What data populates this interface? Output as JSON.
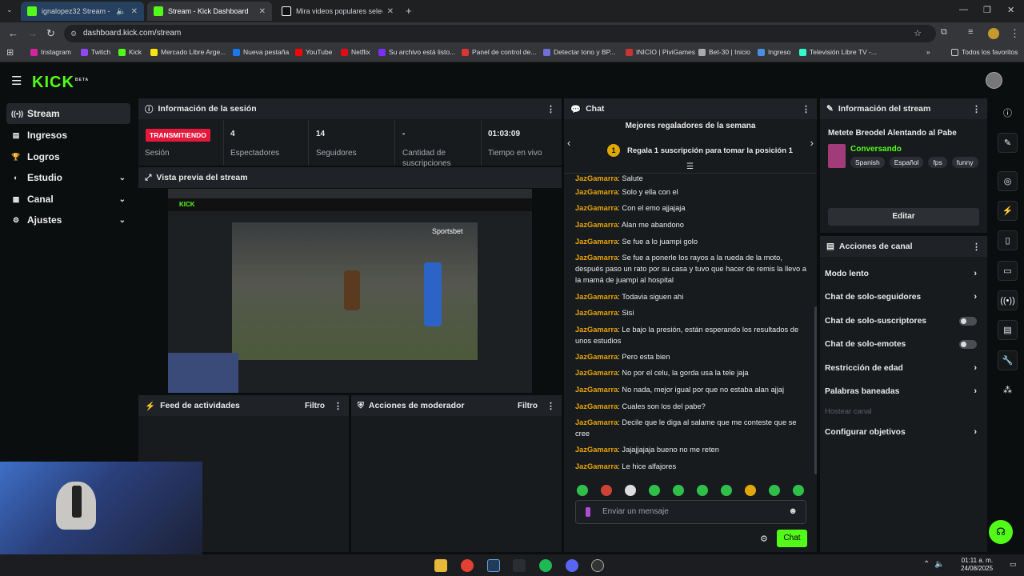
{
  "browser": {
    "tabs": [
      {
        "title": "ignalopez32 Stream - Wat..."
      },
      {
        "title": "Stream - Kick Dashboard"
      },
      {
        "title": "Mira videos populares seleccio"
      }
    ],
    "url": "dashboard.kick.com/stream",
    "bookmarks": [
      "Instagram",
      "Twitch",
      "Kick",
      "Mercado Libre Arge...",
      "Nueva pestaña",
      "YouTube",
      "Netflix",
      "Su archivo está listo...",
      "Panel de control de...",
      "Detectar tono y BP...",
      "INICIO | PiviGames",
      "Bet-30 | Inicio",
      "Ingreso",
      "Televisión Libre TV -..."
    ],
    "all_bookmarks": "Todos los favoritos"
  },
  "app": {
    "logo": "KICK",
    "logo_sup": "BETA"
  },
  "sidebar": {
    "items": [
      {
        "label": "Stream",
        "icon": "broadcast-icon"
      },
      {
        "label": "Ingresos",
        "icon": "revenue-icon"
      },
      {
        "label": "Logros",
        "icon": "trophy-icon"
      },
      {
        "label": "Estudio",
        "icon": "studio-icon"
      },
      {
        "label": "Canal",
        "icon": "channel-icon"
      },
      {
        "label": "Ajustes",
        "icon": "gear-icon"
      }
    ]
  },
  "session": {
    "title": "Información de la sesión",
    "live_badge": "TRANSMITIENDO",
    "live_label": "Sesión",
    "stats": [
      {
        "value": "4",
        "label": "Espectadores"
      },
      {
        "value": "14",
        "label": "Seguidores"
      },
      {
        "value": "-",
        "label": "Cantidad de suscripciones"
      },
      {
        "value": "01:03:09",
        "label": "Tiempo en vivo"
      }
    ]
  },
  "preview": {
    "title": "Vista previa del stream",
    "inner_brand": "Sportsbet",
    "inner_logo": "KICK"
  },
  "feed": {
    "title": "Feed de actividades",
    "filter": "Filtro"
  },
  "mod": {
    "title": "Acciones de moderador",
    "filter": "Filtro"
  },
  "chat": {
    "title": "Chat",
    "gifters_title": "Mejores regaladores de la semana",
    "gift_rank": "1",
    "gift_text": "Regala 1 suscripción para tomar la posición 1",
    "messages": [
      {
        "user": "JazGamarra",
        "text": ": Salute"
      },
      {
        "user": "JazGamarra",
        "text": ": Solo y ella con el"
      },
      {
        "user": "JazGamarra",
        "text": ": Con el emo ajjajaja"
      },
      {
        "user": "JazGamarra",
        "text": ": Alan me abandono"
      },
      {
        "user": "JazGamarra",
        "text": ": Se fue a lo juampi golo"
      },
      {
        "user": "JazGamarra",
        "text": ": Se fue a ponerle los rayos a la rueda de la moto, después paso un rato por su casa y tuvo que hacer de remis la llevo a la mamá de juampi al hospital"
      },
      {
        "user": "JazGamarra",
        "text": ": Todavia siguen ahi"
      },
      {
        "user": "JazGamarra",
        "text": ": Sisi"
      },
      {
        "user": "JazGamarra",
        "text": ": Le bajo la presión, están esperando los resultados de unos estudios"
      },
      {
        "user": "JazGamarra",
        "text": ": Pero esta bien"
      },
      {
        "user": "JazGamarra",
        "text": ": No por el celu, la gorda usa la tele jaja"
      },
      {
        "user": "JazGamarra",
        "text": ": No nada, mejor igual por que no estaba alan ajjaj"
      },
      {
        "user": "JazGamarra",
        "text": ": Cuales son los del pabe?"
      },
      {
        "user": "JazGamarra",
        "text": ": Decile que le diga al salame que me conteste que se cree"
      },
      {
        "user": "JazGamarra",
        "text": ": Jajajjajaja bueno no me reten"
      },
      {
        "user": "JazGamarra",
        "text": ": Le hice alfajores"
      }
    ],
    "input_placeholder": "Enviar un mensaje",
    "send_label": "Chat"
  },
  "stream_info": {
    "title": "Información del stream",
    "stream_title": "Metete Breodel Alentando al Pabe",
    "category": "Conversando",
    "tags": [
      "Spanish",
      "Español",
      "fps",
      "funny"
    ],
    "edit_label": "Editar"
  },
  "channel_actions": {
    "title": "Acciones de canal",
    "items": [
      {
        "label": "Modo lento",
        "control": "chevron"
      },
      {
        "label": "Chat de solo-seguidores",
        "control": "chevron"
      },
      {
        "label": "Chat de solo-suscriptores",
        "control": "toggle",
        "on": false
      },
      {
        "label": "Chat de solo-emotes",
        "control": "toggle",
        "on": false
      },
      {
        "label": "Restricción de edad",
        "control": "chevron"
      },
      {
        "label": "Palabras baneadas",
        "control": "chevron"
      },
      {
        "label": "Hostear canal",
        "control": "disabled"
      },
      {
        "label": "Configurar objetivos",
        "control": "chevron"
      }
    ]
  },
  "taskbar": {
    "time": "01:11 a. m.",
    "date": "24/08/2025"
  },
  "colors": {
    "accent": "#53fc18",
    "live": "#e6193c",
    "username": "#e7a500",
    "bg": "#0b0e0f",
    "panel": "#181b1e"
  }
}
